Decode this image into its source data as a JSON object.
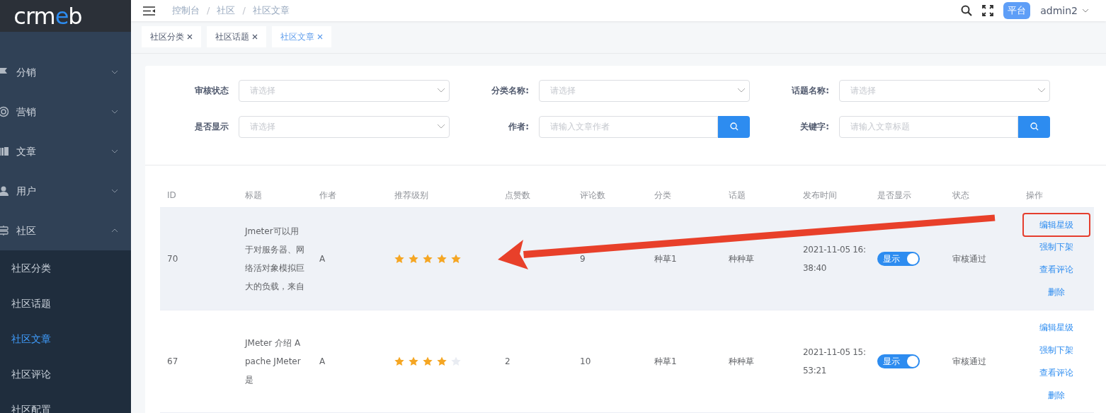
{
  "logo": [
    {
      "text": "crm",
      "accent": false
    },
    {
      "text": "e",
      "accent": true
    },
    {
      "text": "b",
      "accent": false
    }
  ],
  "sidebar": {
    "items": [
      {
        "label": "分销",
        "expanded": false
      },
      {
        "label": "营销",
        "expanded": false
      },
      {
        "label": "文章",
        "expanded": false
      },
      {
        "label": "用户",
        "expanded": false
      },
      {
        "label": "社区",
        "expanded": true,
        "children": [
          {
            "label": "社区分类",
            "selected": false
          },
          {
            "label": "社区话题",
            "selected": false
          },
          {
            "label": "社区文章",
            "selected": true
          },
          {
            "label": "社区评论",
            "selected": false
          },
          {
            "label": "社区配置",
            "selected": false
          }
        ]
      }
    ]
  },
  "breadcrumb": [
    {
      "text": "控制台",
      "kind": "link"
    },
    {
      "text": "/",
      "kind": "separator"
    },
    {
      "text": "社区",
      "kind": "link"
    },
    {
      "text": "/",
      "kind": "separator"
    },
    {
      "text": "社区文章",
      "kind": "current"
    }
  ],
  "header": {
    "badge": "平台",
    "user": "admin2"
  },
  "tabs": [
    {
      "label": "社区分类",
      "selected": false
    },
    {
      "label": "社区话题",
      "selected": false
    },
    {
      "label": "社区文章",
      "selected": true
    }
  ],
  "filters": [
    {
      "label": "审核状态",
      "kind": "select",
      "placeholder": "请选择"
    },
    {
      "label": "分类名称:",
      "kind": "select",
      "placeholder": "请选择"
    },
    {
      "label": "话题名称:",
      "kind": "select",
      "placeholder": "请选择"
    },
    {
      "label": "是否显示",
      "kind": "select",
      "placeholder": "请选择"
    },
    {
      "label": "作者:",
      "kind": "search",
      "placeholder": "请输入文章作者"
    },
    {
      "label": "关键字:",
      "kind": "search",
      "placeholder": "请输入文章标题"
    }
  ],
  "table": {
    "columns": [
      "ID",
      "标题",
      "作者",
      "推荐级别",
      "点赞数",
      "评论数",
      "分类",
      "话题",
      "发布时间",
      "是否显示",
      "状态",
      "操作"
    ],
    "rows": [
      {
        "id": "70",
        "title": "Jmeter可以用于对服务器、网络活对象模拟巨大的负载，来自",
        "author": "A",
        "stars": 5,
        "comments": "9",
        "category": "种草1",
        "topic": "种种草",
        "time": "2021-11-05 16:38:40",
        "show": {
          "on": true,
          "label": "显示"
        },
        "status": "审核通过",
        "hover": true,
        "actions": [
          {
            "label": "编辑星级",
            "highlighted": true
          },
          {
            "label": "强制下架",
            "highlighted": false
          },
          {
            "label": "查看评论",
            "highlighted": false
          },
          {
            "label": "删除",
            "highlighted": false
          }
        ]
      },
      {
        "id": "67",
        "title": "JMeter 介绍 Apache JMeter是",
        "author": "A",
        "stars": 4,
        "likes": "2",
        "comments": "10",
        "category": "种草1",
        "topic": "种种草",
        "time": "2021-11-05 15:53:21",
        "show": {
          "on": true,
          "label": "显示"
        },
        "status": "审核通过",
        "hover": false,
        "actions": [
          {
            "label": "编辑星级",
            "highlighted": false
          },
          {
            "label": "强制下架",
            "highlighted": false
          },
          {
            "label": "查看评论",
            "highlighted": false
          },
          {
            "label": "删除",
            "highlighted": false
          }
        ]
      }
    ]
  },
  "annotation": {
    "arrow": true
  }
}
